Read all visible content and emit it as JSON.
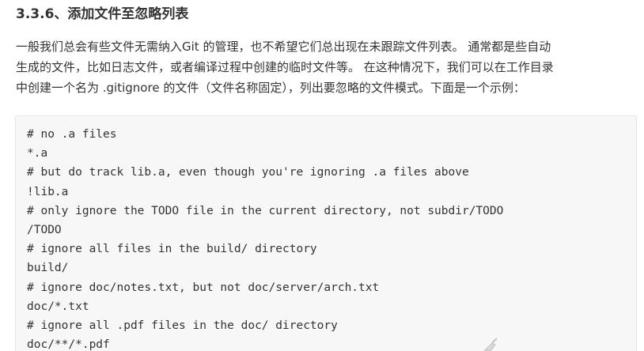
{
  "section": {
    "heading": "3.3.6、添加文件至忽略列表",
    "paragraph_lines": [
      "一般我们总会有些文件无需纳入Git 的管理，也不希望它们总出现在未跟踪文件列表。 通常都是些自动",
      "生成的文件，比如日志文件，或者编译过程中创建的临时文件等。 在这种情况下，我们可以在工作目录",
      "中创建一个名为 .gitignore 的文件（文件名称固定），列出要忽略的文件模式。下面是一个示例："
    ]
  },
  "code_block": {
    "lines": [
      "# no .a files",
      "*.a",
      "# but do track lib.a, even though you're ignoring .a files above",
      "!lib.a",
      "# only ignore the TODO file in the current directory, not subdir/TODO",
      "/TODO",
      "# ignore all files in the build/ directory",
      "build/",
      "# ignore doc/notes.txt, but not doc/server/arch.txt",
      "doc/*.txt",
      "# ignore all .pdf files in the doc/ directory",
      "doc/**/*.pdf"
    ]
  },
  "colors": {
    "text": "#333333",
    "code_background": "#f7f7f7",
    "code_border": "#e6e6e6"
  }
}
